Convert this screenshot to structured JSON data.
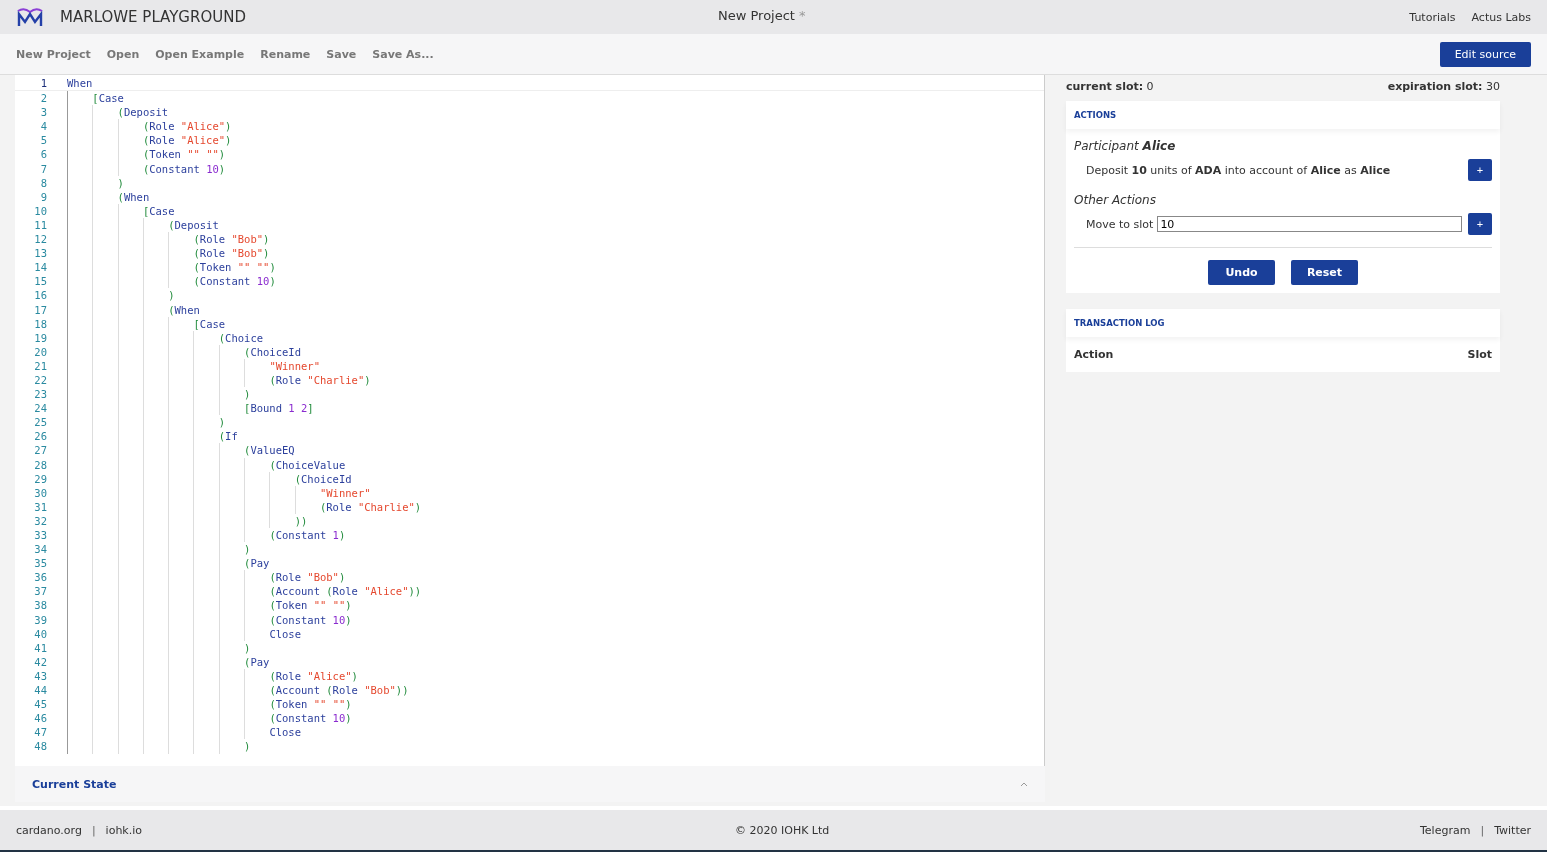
{
  "header": {
    "title": "MARLOWE PLAYGROUND",
    "project": "New Project",
    "unsaved_mark": "*",
    "links": [
      "Tutorials",
      "Actus Labs"
    ]
  },
  "toolbar": {
    "items": [
      "New Project",
      "Open",
      "Open Example",
      "Rename",
      "Save",
      "Save As..."
    ],
    "edit_button": "Edit source"
  },
  "editor": {
    "lines": [
      {
        "n": "1",
        "code": "When",
        "current": true
      },
      {
        "n": "2",
        "code": "    [Case",
        "current": false
      },
      {
        "n": "3",
        "code": "        (Deposit",
        "current": false
      },
      {
        "n": "4",
        "code": "            (Role \"Alice\")",
        "current": false
      },
      {
        "n": "5",
        "code": "            (Role \"Alice\")",
        "current": false
      },
      {
        "n": "6",
        "code": "            (Token \"\" \"\")",
        "current": false
      },
      {
        "n": "7",
        "code": "            (Constant 10)",
        "current": false
      },
      {
        "n": "8",
        "code": "        )",
        "current": false
      },
      {
        "n": "9",
        "code": "        (When",
        "current": false
      },
      {
        "n": "10",
        "code": "            [Case",
        "current": false
      },
      {
        "n": "11",
        "code": "                (Deposit",
        "current": false
      },
      {
        "n": "12",
        "code": "                    (Role \"Bob\")",
        "current": false
      },
      {
        "n": "13",
        "code": "                    (Role \"Bob\")",
        "current": false
      },
      {
        "n": "14",
        "code": "                    (Token \"\" \"\")",
        "current": false
      },
      {
        "n": "15",
        "code": "                    (Constant 10)",
        "current": false
      },
      {
        "n": "16",
        "code": "                )",
        "current": false
      },
      {
        "n": "17",
        "code": "                (When",
        "current": false
      },
      {
        "n": "18",
        "code": "                    [Case",
        "current": false
      },
      {
        "n": "19",
        "code": "                        (Choice",
        "current": false
      },
      {
        "n": "20",
        "code": "                            (ChoiceId",
        "current": false
      },
      {
        "n": "21",
        "code": "                                \"Winner\"",
        "current": false
      },
      {
        "n": "22",
        "code": "                                (Role \"Charlie\")",
        "current": false
      },
      {
        "n": "23",
        "code": "                            )",
        "current": false
      },
      {
        "n": "24",
        "code": "                            [Bound 1 2]",
        "current": false
      },
      {
        "n": "25",
        "code": "                        )",
        "current": false
      },
      {
        "n": "26",
        "code": "                        (If",
        "current": false
      },
      {
        "n": "27",
        "code": "                            (ValueEQ",
        "current": false
      },
      {
        "n": "28",
        "code": "                                (ChoiceValue",
        "current": false
      },
      {
        "n": "29",
        "code": "                                    (ChoiceId",
        "current": false
      },
      {
        "n": "30",
        "code": "                                        \"Winner\"",
        "current": false
      },
      {
        "n": "31",
        "code": "                                        (Role \"Charlie\")",
        "current": false
      },
      {
        "n": "32",
        "code": "                                    ))",
        "current": false
      },
      {
        "n": "33",
        "code": "                                (Constant 1)",
        "current": false
      },
      {
        "n": "34",
        "code": "                            )",
        "current": false
      },
      {
        "n": "35",
        "code": "                            (Pay",
        "current": false
      },
      {
        "n": "36",
        "code": "                                (Role \"Bob\")",
        "current": false
      },
      {
        "n": "37",
        "code": "                                (Account (Role \"Alice\"))",
        "current": false
      },
      {
        "n": "38",
        "code": "                                (Token \"\" \"\")",
        "current": false
      },
      {
        "n": "39",
        "code": "                                (Constant 10)",
        "current": false
      },
      {
        "n": "40",
        "code": "                                Close",
        "current": false
      },
      {
        "n": "41",
        "code": "                            )",
        "current": false
      },
      {
        "n": "42",
        "code": "                            (Pay",
        "current": false
      },
      {
        "n": "43",
        "code": "                                (Role \"Alice\")",
        "current": false
      },
      {
        "n": "44",
        "code": "                                (Account (Role \"Bob\"))",
        "current": false
      },
      {
        "n": "45",
        "code": "                                (Token \"\" \"\")",
        "current": false
      },
      {
        "n": "46",
        "code": "                                (Constant 10)",
        "current": false
      },
      {
        "n": "47",
        "code": "                                Close",
        "current": false
      },
      {
        "n": "48",
        "code": "                            )",
        "current": false
      }
    ]
  },
  "current_state": {
    "label": "Current State",
    "expanded": false
  },
  "simulation": {
    "current_slot_label": "current slot:",
    "current_slot": "0",
    "expiration_label": "expiration slot:",
    "expiration_slot": "30",
    "actions": {
      "title": "ACTIONS",
      "participants": [
        {
          "heading": "Participant **Alice**",
          "actions": [
            {
              "text": "Deposit **10** units of **ADA** into account of **Alice** as **Alice**",
              "button": "+"
            }
          ]
        }
      ],
      "other_title": "Other Actions",
      "move": {
        "label": "Move to slot",
        "value": "10",
        "button": "+"
      },
      "buttons": [
        "Undo",
        "Reset"
      ]
    },
    "log": {
      "title": "TRANSACTION LOG",
      "columns": [
        "Action",
        "Slot"
      ]
    }
  },
  "footer": {
    "left": [
      {
        "kind": "link",
        "text": "cardano.org"
      },
      {
        "kind": "sep",
        "text": "|"
      },
      {
        "kind": "link",
        "text": "iohk.io"
      }
    ],
    "copyright": "© 2020 IOHK Ltd",
    "right": [
      {
        "kind": "link",
        "text": "Telegram"
      },
      {
        "kind": "sep",
        "text": "|"
      },
      {
        "kind": "link",
        "text": "Twitter"
      }
    ]
  }
}
